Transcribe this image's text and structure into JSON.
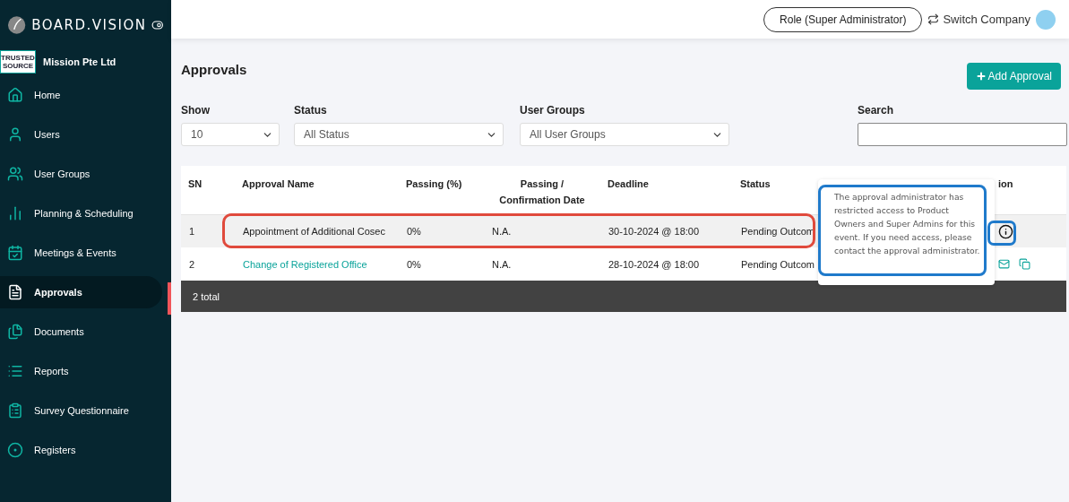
{
  "brand": {
    "name": "BOARD.VISION"
  },
  "company": {
    "name": "Mission Pte Ltd",
    "logo_text": [
      "TRUSTED",
      "SOURCE"
    ]
  },
  "sidebar": {
    "items": [
      {
        "label": "Home",
        "selected": false
      },
      {
        "label": "Users",
        "selected": false
      },
      {
        "label": "User Groups",
        "selected": false
      },
      {
        "label": "Planning & Scheduling",
        "selected": false
      },
      {
        "label": "Meetings & Events",
        "selected": false
      },
      {
        "label": "Approvals",
        "selected": true
      },
      {
        "label": "Documents",
        "selected": false
      },
      {
        "label": "Reports",
        "selected": false
      },
      {
        "label": "Survey Questionnaire",
        "selected": false
      },
      {
        "label": "Registers",
        "selected": false
      }
    ]
  },
  "topbar": {
    "role": "Role (Super Administrator)",
    "switch": "Switch Company"
  },
  "page": {
    "title": "Approvals",
    "add_button": "Add Approval"
  },
  "filters": [
    {
      "kind": "select",
      "label": "Show",
      "value": "10"
    },
    {
      "kind": "select",
      "label": "Status",
      "value": "All Status"
    },
    {
      "kind": "select",
      "label": "User Groups",
      "value": "All User Groups"
    },
    {
      "kind": "input",
      "label": "Search"
    }
  ],
  "table": {
    "columns": [
      "SN",
      "Approval Name",
      "Passing (%)",
      "Passing / Confirmation Date",
      "Deadline",
      "Status",
      "",
      "ion"
    ],
    "rows": [
      {
        "cells": [
          "1",
          "Appointment of Additional Cosec",
          "0%",
          "N.A.",
          "30-10-2024 @ 18:00",
          "Pending Outcom"
        ],
        "link": false,
        "highlighted": true,
        "kind": "restricted"
      },
      {
        "cells": [
          "2",
          "Change of Registered Office",
          "0%",
          "N.A.",
          "28-10-2024 @ 18:00",
          "Pending Outcom"
        ],
        "link": true,
        "highlighted": false,
        "kind": "open"
      }
    ],
    "footer": "2 total"
  },
  "tooltip": {
    "text": "The approval administrator has restricted access to Product Owners and Super Admins for this event. If you need access, please contact the approval administrator."
  }
}
